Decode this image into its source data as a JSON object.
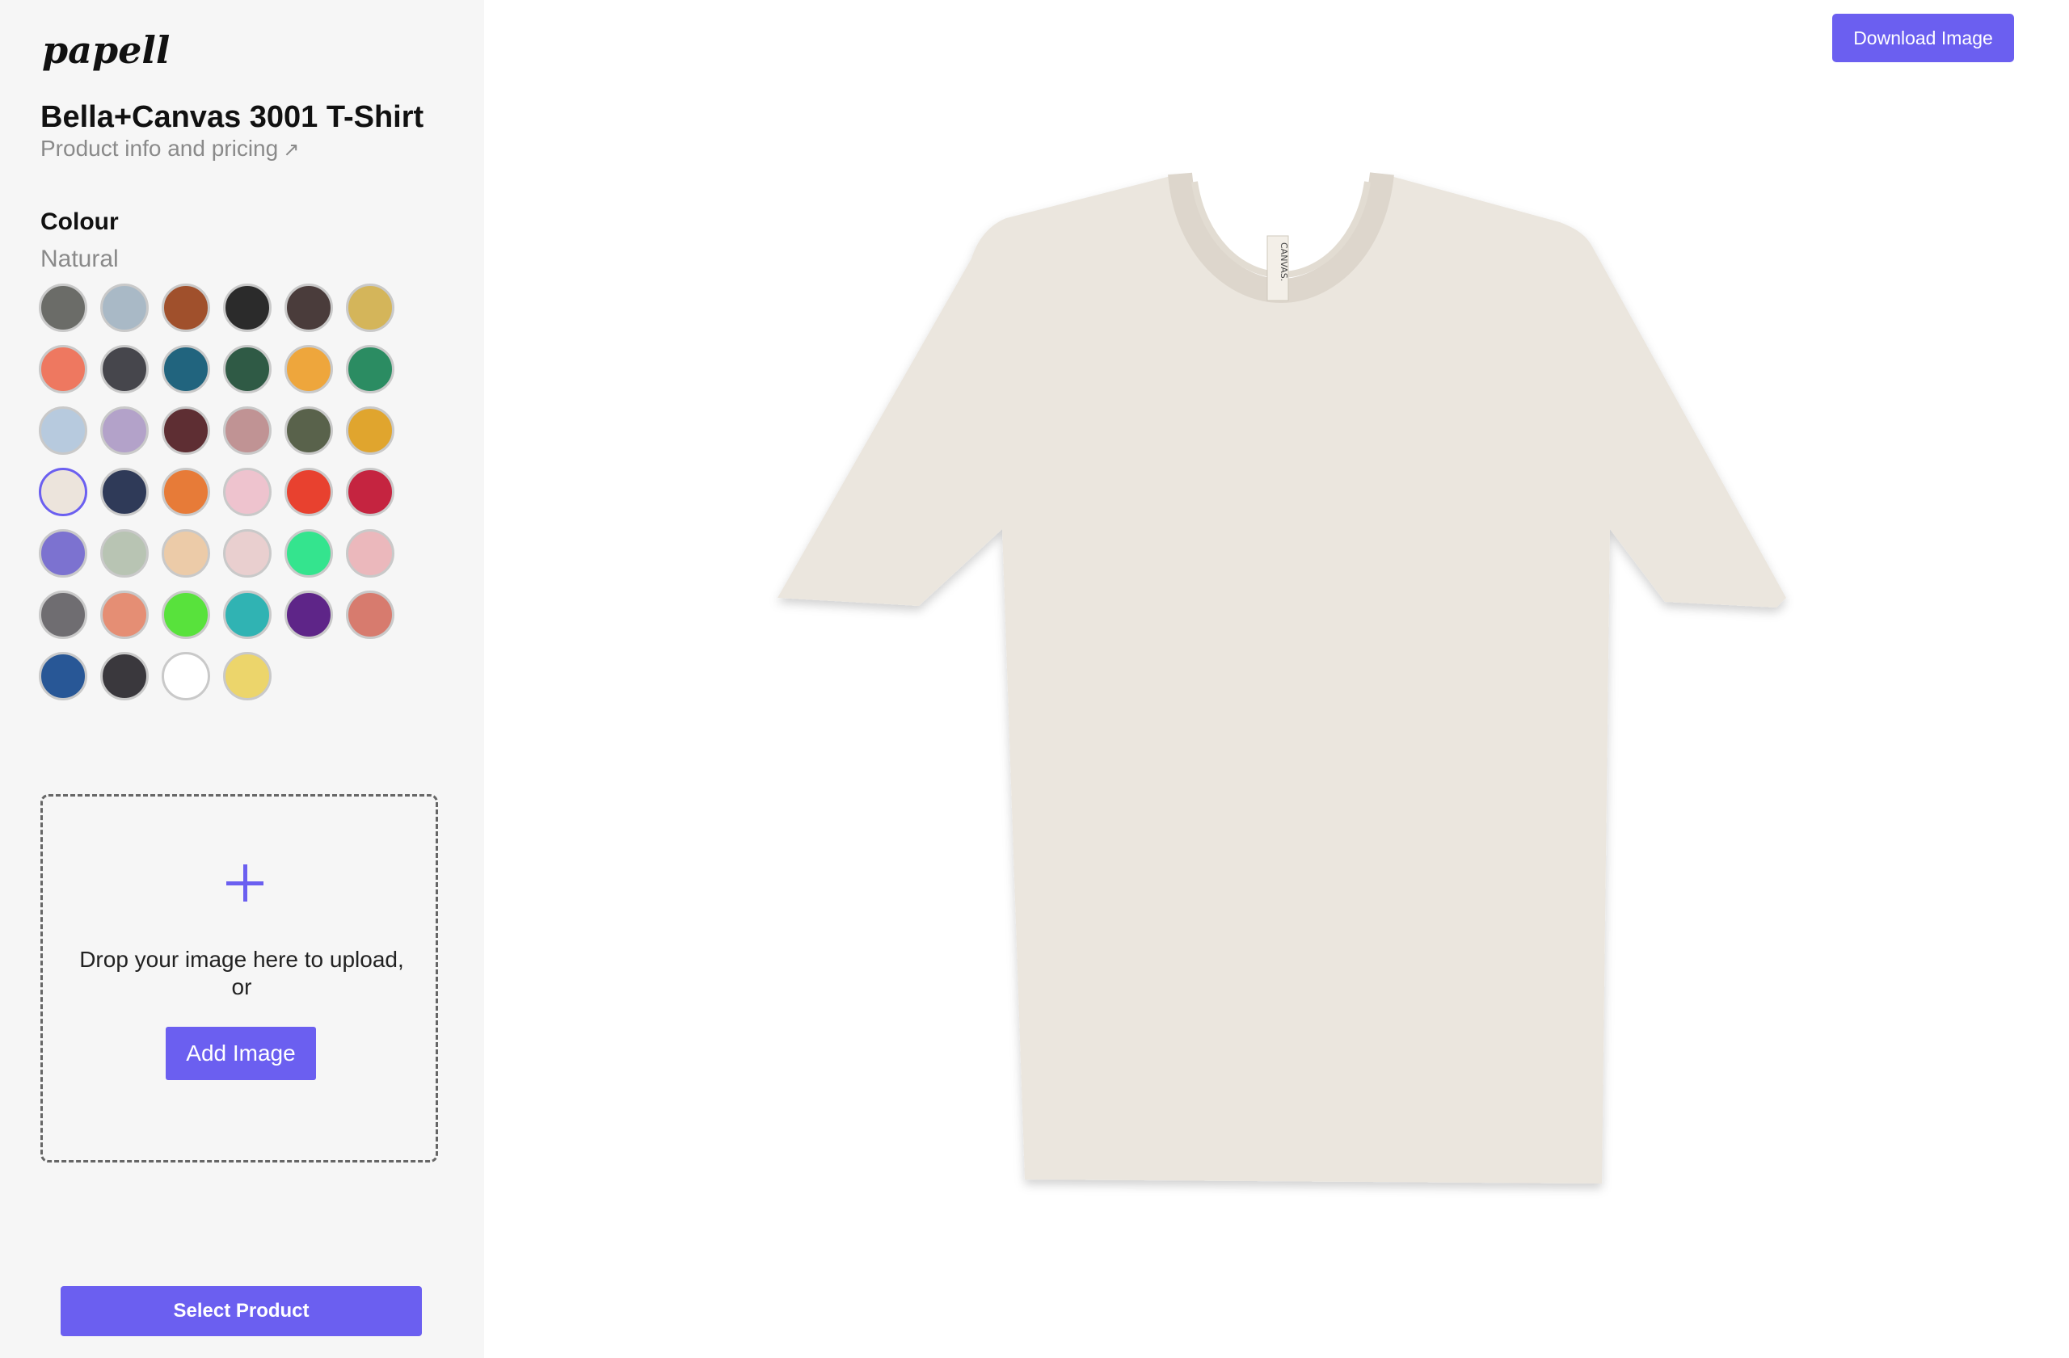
{
  "brand": {
    "logo_text": "papello"
  },
  "product": {
    "title": "Bella+Canvas 3001 T-Shirt",
    "link_label": "Product info and pricing",
    "link_icon": "arrow-up-right-icon"
  },
  "colour": {
    "label": "Colour",
    "selected_name": "Natural",
    "swatches": [
      "#6b6c68",
      "#a9b9c6",
      "#a0502c",
      "#2b2b2b",
      "#4a3c3b",
      "#d4b55a",
      "#ee7860",
      "#46464c",
      "#21647e",
      "#2f5a45",
      "#eea63c",
      "#2b8c62",
      "#b7cade",
      "#b3a2c9",
      "#5e2e33",
      "#c09394",
      "#59624b",
      "#e0a52e",
      "#ece4dc",
      "#2f3a58",
      "#e77b38",
      "#eec3ce",
      "#e8412f",
      "#c52440",
      "#7c72d0",
      "#b8c4b3",
      "#eccba8",
      "#e9cfcf",
      "#34e48e",
      "#ebb8bc",
      "#6f6d71",
      "#e58e74",
      "#58e23c",
      "#30b3b3",
      "#5e2588",
      "#d77b6e",
      "#285796",
      "#3a383d",
      "#ffffff",
      "#ecd56b"
    ],
    "selected_index": 18
  },
  "upload": {
    "drop_text": "Drop your image here to upload, or",
    "add_button": "Add Image",
    "icon": "plus-icon"
  },
  "actions": {
    "select_product": "Select Product",
    "download": "Download Image"
  },
  "preview": {
    "shirt_color": "#ebe6de",
    "tag_text": "CANVAS."
  },
  "colors": {
    "accent": "#6b5ff0",
    "sidebar_bg": "#f6f6f6"
  }
}
